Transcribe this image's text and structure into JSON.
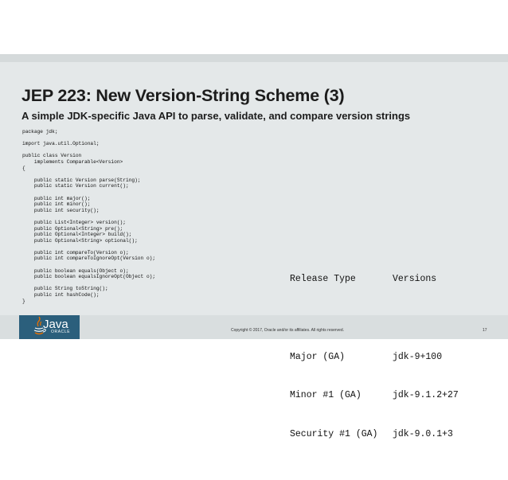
{
  "slide": {
    "title": "JEP 223: New Version-String Scheme (3)",
    "subtitle": "A simple JDK-specific Java API to parse, validate, and compare version strings"
  },
  "code_lines": [
    "package jdk;",
    "",
    "import java.util.Optional;",
    "",
    "public class Version",
    "    implements Comparable<Version>",
    "{",
    "",
    "    public static Version parse(String);",
    "    public static Version current();",
    "",
    "    public int major();",
    "    public int minor();",
    "    public int security();",
    "",
    "    public List<Integer> version();",
    "    public Optional<String> pre();",
    "    public Optional<Integer> build();",
    "    public Optional<String> optional();",
    "",
    "    public int compareTo(Version o);",
    "    public int compareToIgnoreOpt(Version o);",
    "",
    "    public boolean equals(Object o);",
    "    public boolean equalsIgnoreOpt(Object o);",
    "",
    "    public String toString();",
    "    public int hashCode();",
    "}"
  ],
  "release_table": {
    "headers": [
      "Release Type",
      "Versions"
    ],
    "separators": [
      "----------------",
      "-----------"
    ],
    "rows": [
      [
        "Major (GA)",
        "jdk-9+100"
      ],
      [
        "Minor #1 (GA)",
        "jdk-9.1.2+27"
      ],
      [
        "Security #1 (GA)",
        "jdk-9.0.1+3"
      ]
    ]
  },
  "footer": {
    "logo_text": "Java",
    "logo_subtext": "ORACLE",
    "copyright": "Copyright © 2017, Oracle and/or its affiliates. All rights reserved.",
    "page_number": "17"
  },
  "colors": {
    "slide_background": "#e4e8e9",
    "logo_background": "#2b5f7c",
    "java_cup_orange": "#e76f00"
  },
  "icons": {
    "logo": "java-coffee-cup-icon"
  }
}
